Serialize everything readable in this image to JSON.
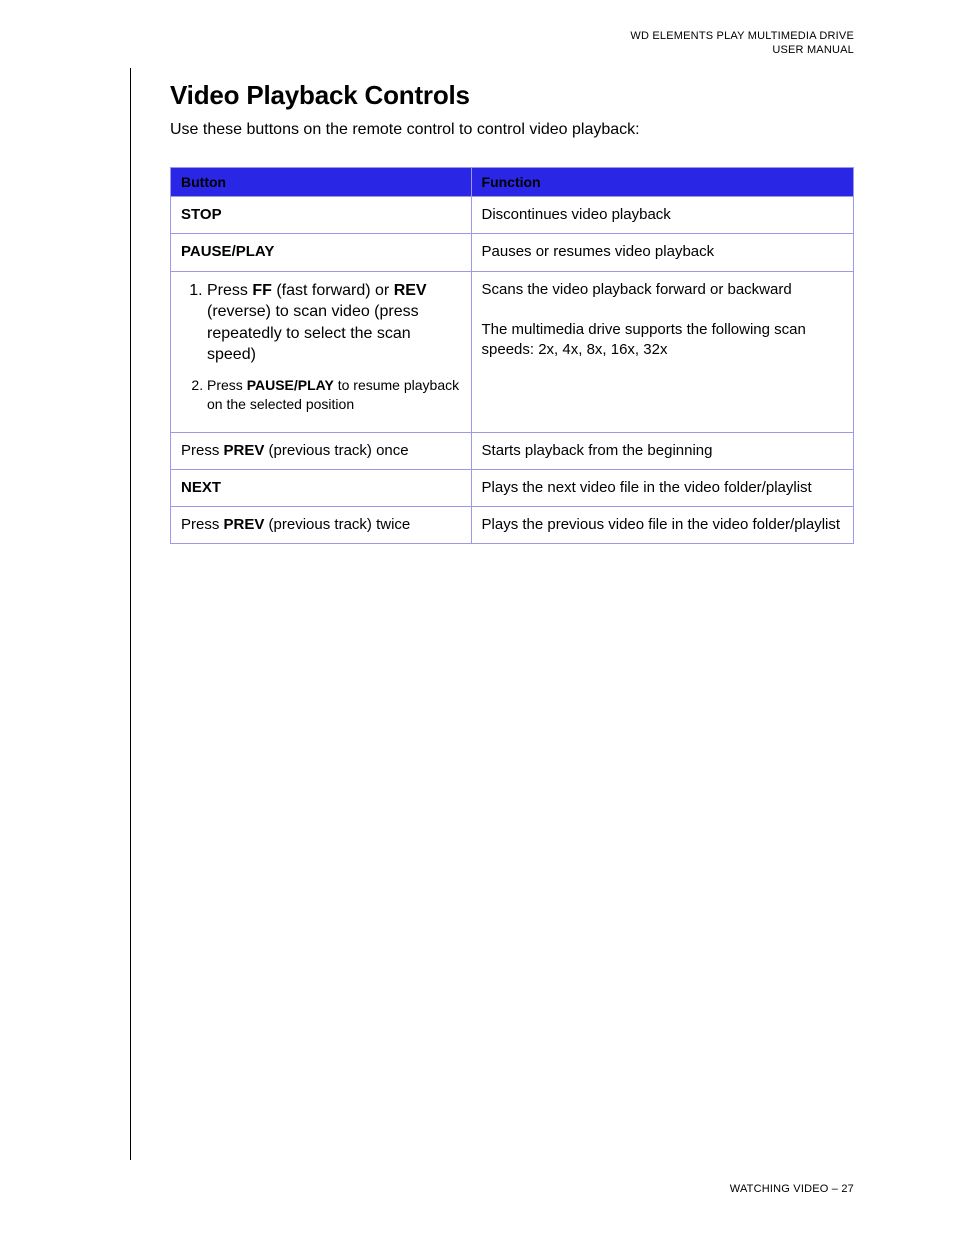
{
  "header": {
    "line1": "WD ELEMENTS PLAY MULTIMEDIA DRIVE",
    "line2": "USER MANUAL"
  },
  "section": {
    "title": "Video Playback Controls",
    "intro": "Use these buttons on the remote control to control video playback:"
  },
  "table": {
    "headers": {
      "button": "Button",
      "function": "Function"
    },
    "rows": [
      {
        "button_html": "<span class='b'>STOP</span>",
        "function_html": "Discontinues video playback"
      },
      {
        "button_html": "<span class='b'>PAUSE/PLAY</span>",
        "function_html": "Pauses or resumes video playback"
      },
      {
        "button_html": "<ol class='steps'><li>Press <span class='b'>FF</span> (fast forward) or <span class='b'>REV</span> (reverse) to scan video (press repeatedly to select the scan speed)</li><li class='small'>Press <span class='b'>PAUSE/PLAY</span> to resume playback on the selected position</li></ol>",
        "function_html": "Scans the video playback forward or backward<br><br>The multimedia drive supports the following scan speeds: 2x, 4x, 8x, 16x, 32x"
      },
      {
        "button_html": "Press <span class='b'>PREV</span> (previous track) once",
        "function_html": "Starts playback from the beginning"
      },
      {
        "button_html": "<span class='b'>NEXT</span>",
        "function_html": "Plays the next video file in the video folder/playlist"
      },
      {
        "button_html": "Press <span class='b'>PREV</span> (previous track) twice",
        "function_html": "Plays the previous video file in the video folder/playlist"
      }
    ]
  },
  "footer": {
    "section_label": "WATCHING VIDEO",
    "separator": " – ",
    "page_number": "27"
  }
}
